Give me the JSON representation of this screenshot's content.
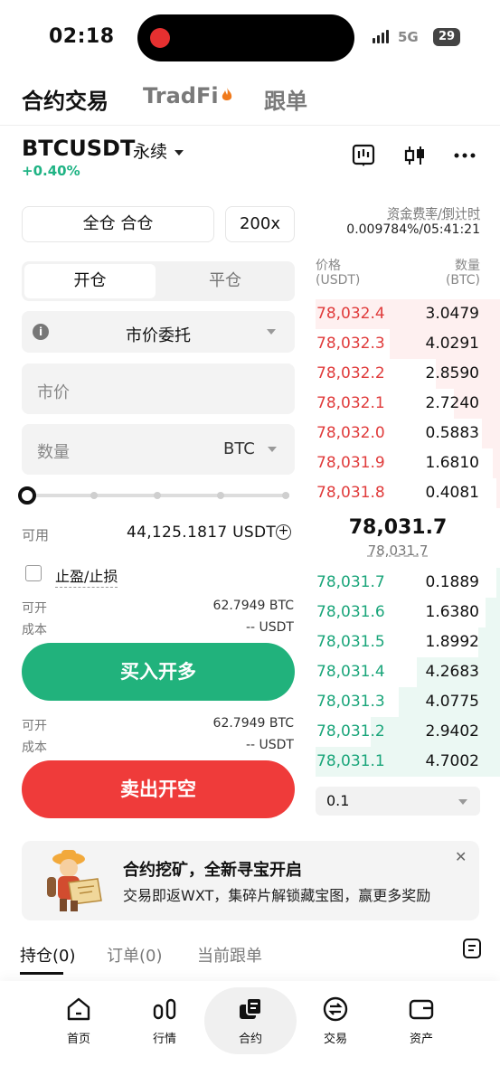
{
  "status_bar": {
    "time": "02:18",
    "network": "5G",
    "battery": "29"
  },
  "top_tabs": [
    {
      "label": "合约交易",
      "active": true
    },
    {
      "label": "TradFi",
      "active": false
    },
    {
      "label": "跟单",
      "active": false
    }
  ],
  "symbol": {
    "name": "BTCUSDT",
    "type": "永续",
    "change": "+0.40%"
  },
  "funding": {
    "label": "资金费率/倒计时",
    "value": "0.009784%/05:41:21"
  },
  "controls": {
    "margin_mode": "全仓 合仓",
    "leverage": "200x",
    "open_tab": "开仓",
    "close_tab": "平仓",
    "order_type": "市价委托",
    "price_placeholder": "市价",
    "qty_placeholder": "数量",
    "qty_unit": "BTC",
    "slider_percent": 0
  },
  "available": {
    "label": "可用",
    "value": "44,125.1817 USDT"
  },
  "tpsl_label": "止盈/止损",
  "buy_info": {
    "can_open_label": "可开",
    "can_open": "62.7949 BTC",
    "cost_label": "成本",
    "cost": "-- USDT"
  },
  "sell_info": {
    "can_open_label": "可开",
    "can_open": "62.7949 BTC",
    "cost_label": "成本",
    "cost": "-- USDT"
  },
  "buy_button": "买入开多",
  "sell_button": "卖出开空",
  "orderbook": {
    "price_header": "价格",
    "price_unit": "(USDT)",
    "qty_header": "数量",
    "qty_unit": "(BTC)",
    "asks": [
      {
        "price": "78,032.4",
        "qty": "3.0479",
        "depth": 1.0
      },
      {
        "price": "78,032.3",
        "qty": "4.0291",
        "depth": 0.6
      },
      {
        "price": "78,032.2",
        "qty": "2.8590",
        "depth": 0.35
      },
      {
        "price": "78,032.1",
        "qty": "2.7240",
        "depth": 0.25
      },
      {
        "price": "78,032.0",
        "qty": "0.5883",
        "depth": 0.1
      },
      {
        "price": "78,031.9",
        "qty": "1.6810",
        "depth": 0.04
      },
      {
        "price": "78,031.8",
        "qty": "0.4081",
        "depth": 0.02
      }
    ],
    "last_price": "78,031.7",
    "mark_price": "78,031.7",
    "bids": [
      {
        "price": "78,031.7",
        "qty": "0.1889",
        "depth": 0.02
      },
      {
        "price": "78,031.6",
        "qty": "1.6380",
        "depth": 0.08
      },
      {
        "price": "78,031.5",
        "qty": "1.8992",
        "depth": 0.12
      },
      {
        "price": "78,031.4",
        "qty": "4.2683",
        "depth": 0.45
      },
      {
        "price": "78,031.3",
        "qty": "4.0775",
        "depth": 0.55
      },
      {
        "price": "78,031.2",
        "qty": "2.9402",
        "depth": 0.7
      },
      {
        "price": "78,031.1",
        "qty": "4.7002",
        "depth": 1.0
      }
    ],
    "depth_step": "0.1"
  },
  "banner": {
    "title": "合约挖矿，全新寻宝开启",
    "subtitle": "交易即返WXT，集碎片解锁藏宝图，赢更多奖励"
  },
  "bottom_tabs": [
    {
      "label": "持仓(0)",
      "active": true
    },
    {
      "label": "订单(0)",
      "active": false
    },
    {
      "label": "当前跟单",
      "active": false
    }
  ],
  "nav": [
    {
      "label": "首页",
      "icon": "home-icon"
    },
    {
      "label": "行情",
      "icon": "market-icon"
    },
    {
      "label": "合约",
      "icon": "futures-icon",
      "active": true
    },
    {
      "label": "交易",
      "icon": "trade-icon"
    },
    {
      "label": "资产",
      "icon": "wallet-icon"
    }
  ],
  "colors": {
    "buy": "#21b27c",
    "sell": "#ef3b3a",
    "ask_text": "#e03b3b",
    "bid_text": "#1aa57a"
  }
}
